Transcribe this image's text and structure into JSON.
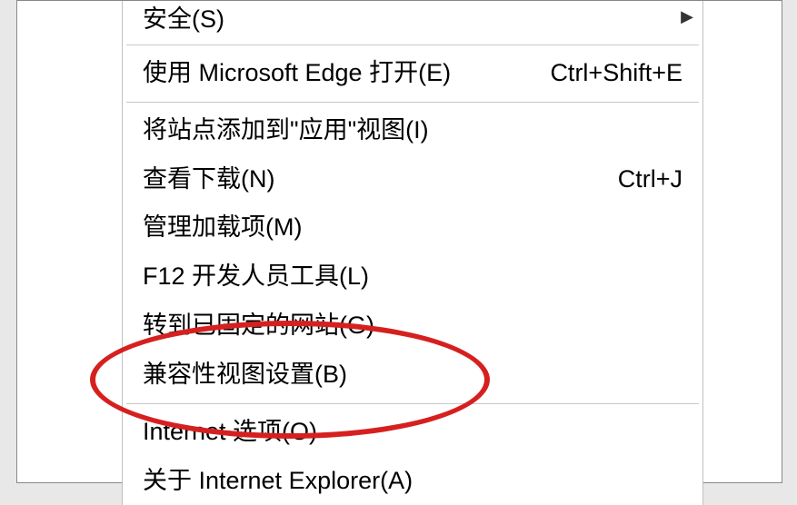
{
  "menu": {
    "partial_item": {
      "label": "安全(S)",
      "has_submenu": true
    },
    "items": [
      {
        "label": "使用 Microsoft Edge 打开(E)",
        "shortcut": "Ctrl+Shift+E"
      }
    ],
    "items2": [
      {
        "label": "将站点添加到\"应用\"视图(I)",
        "shortcut": ""
      },
      {
        "label": "查看下载(N)",
        "shortcut": "Ctrl+J"
      },
      {
        "label": "管理加载项(M)",
        "shortcut": ""
      },
      {
        "label": "F12 开发人员工具(L)",
        "shortcut": ""
      },
      {
        "label": "转到已固定的网站(G)",
        "shortcut": ""
      },
      {
        "label": "兼容性视图设置(B)",
        "shortcut": ""
      }
    ],
    "items3": [
      {
        "label": "Internet 选项(O)",
        "shortcut": ""
      },
      {
        "label": "关于 Internet Explorer(A)",
        "shortcut": ""
      }
    ]
  },
  "annotation": {
    "highlight_target": "internet-options"
  }
}
